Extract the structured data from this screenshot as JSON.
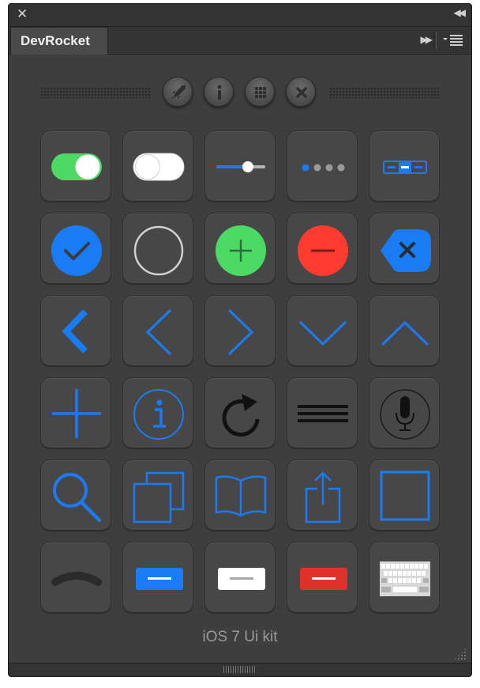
{
  "panel": {
    "close_glyph": "✕",
    "collapse_glyph": "◀◀",
    "tab_title": "DevRocket",
    "expand_glyph": "▶▶",
    "footer": "iOS 7 Ui kit"
  },
  "toolbar": {
    "buttons": [
      {
        "icon": "rocket-icon"
      },
      {
        "icon": "info-icon"
      },
      {
        "icon": "grid-icon"
      },
      {
        "icon": "close-icon"
      }
    ]
  },
  "icon_grid": [
    [
      "toggle-on-icon",
      "toggle-off-icon",
      "slider-icon",
      "page-dots-icon",
      "segmented-control-icon"
    ],
    [
      "checkmark-circle-icon",
      "empty-circle-icon",
      "add-circle-icon",
      "remove-circle-icon",
      "delete-backspace-icon"
    ],
    [
      "back-chevron-bold-icon",
      "chevron-left-icon",
      "chevron-right-icon",
      "chevron-down-icon",
      "chevron-up-icon"
    ],
    [
      "plus-icon",
      "info-circle-icon",
      "refresh-icon",
      "hamburger-menu-icon",
      "microphone-icon"
    ],
    [
      "search-icon",
      "copy-squares-icon",
      "book-icon",
      "share-icon",
      "square-outline-icon"
    ],
    [
      "grabber-handle-icon",
      "blue-button-icon",
      "white-button-icon",
      "red-button-icon",
      "keyboard-icon"
    ]
  ],
  "colors": {
    "accent_blue": "#1a7cf5",
    "green": "#4cd964",
    "red": "#ff3b30",
    "panel_bg": "#3e3e3e",
    "tile_bg": "#474747"
  }
}
